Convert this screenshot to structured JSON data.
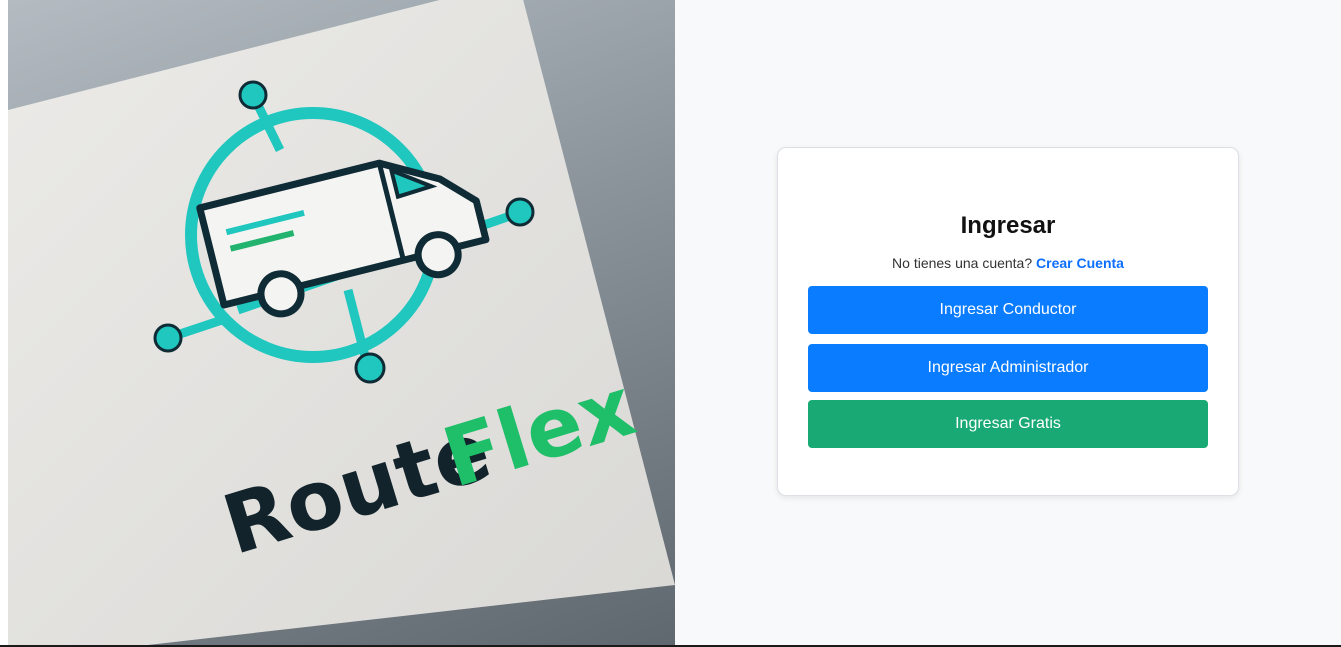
{
  "hero": {
    "logo_text_route": "Route",
    "logo_text_flex": "Flex"
  },
  "login": {
    "title": "Ingresar",
    "no_account_text": "No tienes una cuenta?",
    "create_account_link": "Crear Cuenta",
    "driver_button": "Ingresar Conductor",
    "admin_button": "Ingresar Administrador",
    "free_button": "Ingresar Gratis"
  },
  "colors": {
    "primary": "#0a7cff",
    "success": "#19a974",
    "link": "#0d6efd",
    "background": "#f8f9fa"
  }
}
